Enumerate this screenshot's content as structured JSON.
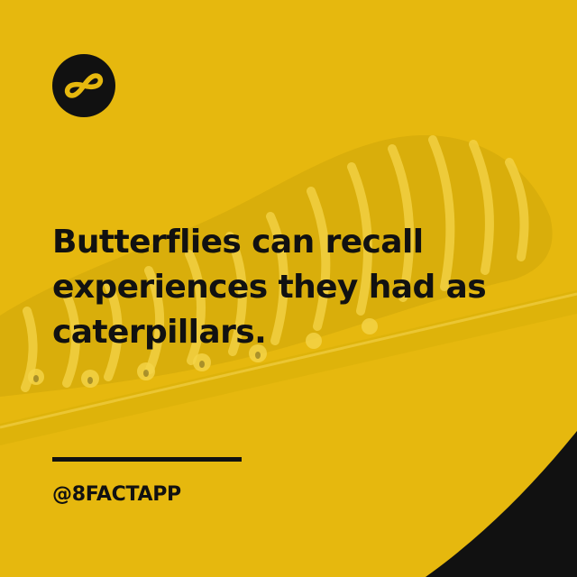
{
  "fact": {
    "lines": [
      "Butterflies can recall",
      "experiences they had as",
      "caterpillars."
    ]
  },
  "footer": {
    "handle": "@8FACTAPP"
  },
  "colors": {
    "background": "#E6B80E",
    "text": "#111111",
    "corner": "#111111",
    "caterpillar_tint": "#F5CF3A"
  },
  "icons": {
    "logo": "eight-infinity-logo-icon",
    "background_image": "caterpillar-photo"
  }
}
